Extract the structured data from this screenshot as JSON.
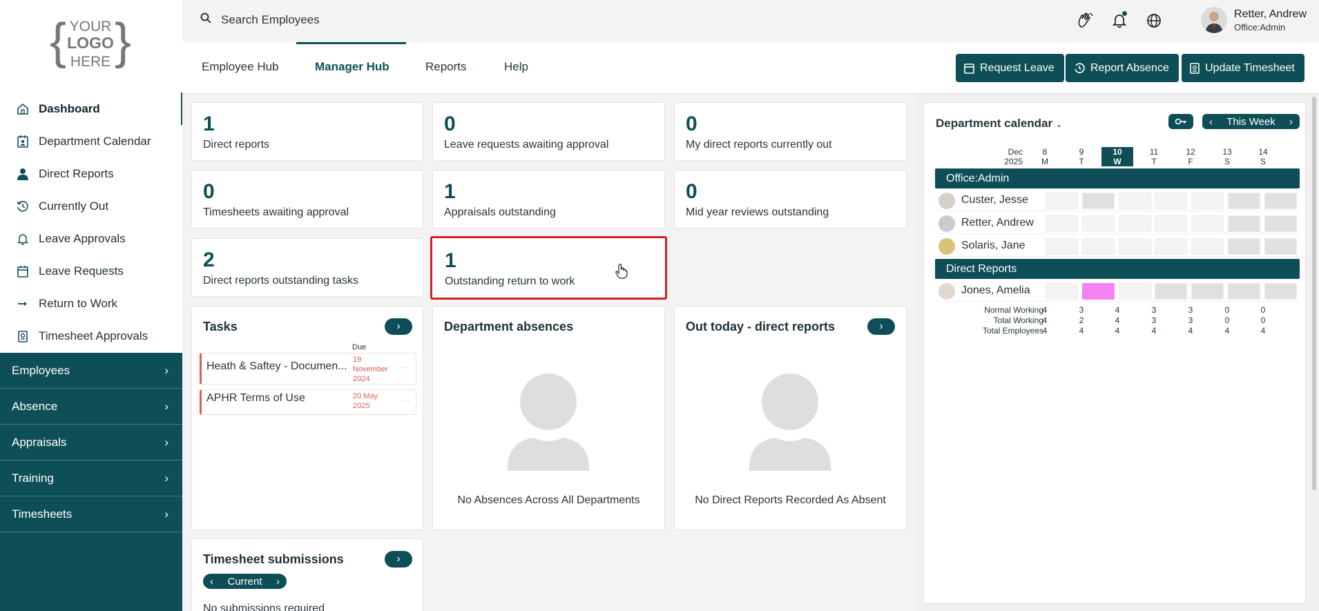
{
  "sidebar": {
    "logo": {
      "line1": "YOUR",
      "line2": "LOGO",
      "line3": "HERE"
    },
    "items": [
      {
        "label": "Dashboard",
        "icon": "home-icon"
      },
      {
        "label": "Department Calendar",
        "icon": "calendar-user-icon"
      },
      {
        "label": "Direct Reports",
        "icon": "person-icon"
      },
      {
        "label": "Currently Out",
        "icon": "history-icon"
      },
      {
        "label": "Leave Approvals",
        "icon": "bell-icon"
      },
      {
        "label": "Leave Requests",
        "icon": "calendar-icon"
      },
      {
        "label": "Return to Work",
        "icon": "arrow-right-icon"
      },
      {
        "label": "Timesheet Approvals",
        "icon": "timesheet-icon"
      }
    ],
    "sections": [
      "Employees",
      "Absence",
      "Appraisals",
      "Training",
      "Timesheets"
    ]
  },
  "topbar": {
    "search_placeholder": "Search Employees",
    "user_name": "Retter, Andrew",
    "user_role": "Office:Admin"
  },
  "tabs": [
    "Employee Hub",
    "Manager Hub",
    "Reports",
    "Help"
  ],
  "actions": [
    "Request Leave",
    "Report Absence",
    "Update Timesheet"
  ],
  "stats": [
    {
      "value": "1",
      "label": "Direct reports"
    },
    {
      "value": "0",
      "label": "Leave requests awaiting approval"
    },
    {
      "value": "0",
      "label": "My direct reports currently out"
    },
    {
      "value": "0",
      "label": "Timesheets awaiting approval"
    },
    {
      "value": "1",
      "label": "Appraisals outstanding"
    },
    {
      "value": "0",
      "label": "Mid year reviews outstanding"
    },
    {
      "value": "2",
      "label": "Direct reports outstanding tasks"
    },
    {
      "value": "1",
      "label": "Outstanding return to work"
    }
  ],
  "tasks": {
    "title": "Tasks",
    "due_label": "Due",
    "items": [
      {
        "name": "Heath & Saftey - Documen...",
        "due": "19 November 2024"
      },
      {
        "name": "APHR Terms of Use",
        "due": "20 May 2025"
      }
    ]
  },
  "absences": {
    "title": "Department absences",
    "empty": "No Absences Across All Departments"
  },
  "out_today": {
    "title": "Out today - direct reports",
    "empty": "No Direct Reports Recorded As Absent"
  },
  "timesheets": {
    "title": "Timesheet submissions",
    "period": "Current",
    "empty": "No submissions required"
  },
  "calendar": {
    "title": "Department calendar",
    "range": "This Week",
    "month": "Dec",
    "year": "2025",
    "days": [
      {
        "num": "8",
        "dow": "M"
      },
      {
        "num": "9",
        "dow": "T"
      },
      {
        "num": "10",
        "dow": "W"
      },
      {
        "num": "11",
        "dow": "T"
      },
      {
        "num": "12",
        "dow": "F"
      },
      {
        "num": "13",
        "dow": "S"
      },
      {
        "num": "14",
        "dow": "S"
      }
    ],
    "groups": [
      {
        "name": "Office:Admin",
        "people": [
          "Custer, Jesse",
          "Retter, Andrew",
          "Solaris, Jane"
        ]
      },
      {
        "name": "Direct Reports",
        "people": [
          "Jones, Amelia"
        ]
      }
    ],
    "summary": [
      {
        "label": "Normal Working",
        "values": [
          "4",
          "3",
          "4",
          "3",
          "3",
          "0",
          "0"
        ]
      },
      {
        "label": "Total Working",
        "values": [
          "4",
          "2",
          "4",
          "3",
          "3",
          "0",
          "0"
        ]
      },
      {
        "label": "Total Employees",
        "values": [
          "4",
          "4",
          "4",
          "4",
          "4",
          "4",
          "4"
        ]
      }
    ]
  }
}
